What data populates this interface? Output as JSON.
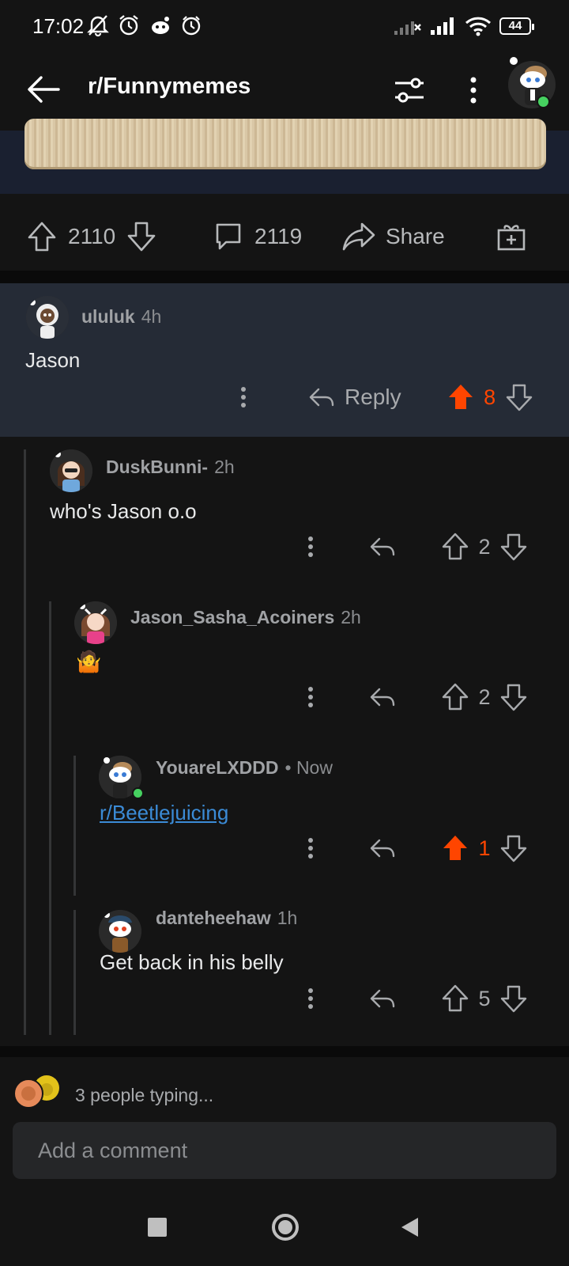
{
  "status_bar": {
    "time": "17:02",
    "battery": "44",
    "icons": [
      "mute-icon",
      "alarm-icon",
      "reddit-icon",
      "clock-icon",
      "no-signal-icon",
      "signal-icon",
      "wifi-icon",
      "battery-icon"
    ]
  },
  "header": {
    "title": "r/Funnymemes"
  },
  "post_actions": {
    "upvotes": "2110",
    "comments": "2119",
    "share_label": "Share"
  },
  "comments": [
    {
      "user": "ululuk",
      "time": "4h",
      "body": "Jason",
      "reply_label": "Reply",
      "votes": "8",
      "upvoted": true
    },
    {
      "user": "DuskBunni-",
      "time": "2h",
      "body": "who's Jason o.o",
      "votes": "2",
      "upvoted": false
    },
    {
      "user": "Jason_Sasha_Acoiners",
      "time": "2h",
      "body": "🤷",
      "votes": "2",
      "upvoted": false
    },
    {
      "user": "YouareLXDDD",
      "time": "• Now",
      "body": "r/Beetlejuicing",
      "votes": "1",
      "upvoted": true
    },
    {
      "user": "danteheehaw",
      "time": "1h",
      "body": "Get back in his belly",
      "votes": "5",
      "upvoted": false
    }
  ],
  "typing": {
    "text": "3 people typing..."
  },
  "comment_box": {
    "placeholder": "Add a comment"
  },
  "colors": {
    "upvote": "#ff4500",
    "link": "#3b8bd6",
    "online": "#46d160",
    "highlight": "#252b36"
  }
}
